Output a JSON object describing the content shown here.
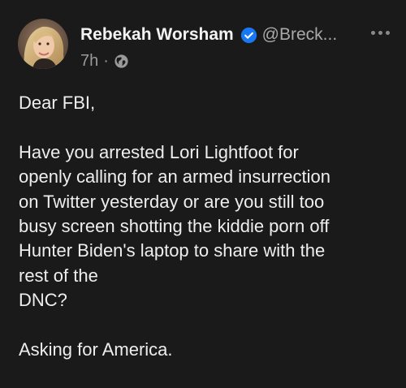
{
  "post": {
    "author": {
      "display_name": "Rebekah Worsham",
      "handle": "@Breck...",
      "verified": true,
      "avatar_icon": "profile-photo"
    },
    "time": "7h",
    "separator": "·",
    "visibility_icon": "globe-icon",
    "more_icon": "more-horizontal-icon",
    "body": "Dear FBI,\n\nHave you arrested Lori Lightfoot for\nopenly calling for an armed insurrection\non Twitter yesterday or are you still too\nbusy screen shotting the kiddie porn off\nHunter Biden's laptop to share with the\nrest of the\nDNC?\n\nAsking for America."
  },
  "colors": {
    "background": "#1a1a1a",
    "text": "#eeeeee",
    "muted": "#9a9a9a",
    "verified_badge": "#1877f2"
  }
}
